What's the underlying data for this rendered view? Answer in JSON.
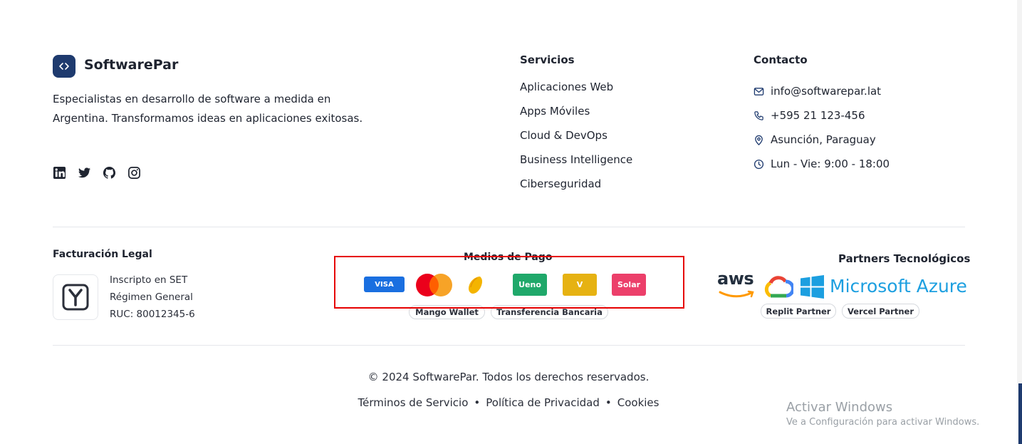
{
  "brand": {
    "name": "SoftwarePar",
    "description": "Especialistas en desarrollo de software a medida en Argentina. Transformamos ideas en aplicaciones exitosas.",
    "logo_color": "#1e3a6e",
    "social_icons": [
      "linkedin-icon",
      "twitter-icon",
      "github-icon",
      "instagram-icon"
    ]
  },
  "services": {
    "title": "Servicios",
    "items": [
      "Aplicaciones Web",
      "Apps Móviles",
      "Cloud & DevOps",
      "Business Intelligence",
      "Ciberseguridad"
    ]
  },
  "contact": {
    "title": "Contacto",
    "items": [
      {
        "icon": "mail-icon",
        "text": "info@softwarepar.lat"
      },
      {
        "icon": "phone-icon",
        "text": "+595 21 123-456"
      },
      {
        "icon": "map-pin-icon",
        "text": "Asunción, Paraguay"
      },
      {
        "icon": "clock-icon",
        "text": "Lun - Vie: 9:00 - 18:00"
      }
    ]
  },
  "billing": {
    "title": "Facturación Legal",
    "lines": [
      "Inscripto en SET",
      "Régimen General",
      "RUC: 80012345-6"
    ]
  },
  "payment": {
    "title": "Medios de Pago",
    "chips": [
      {
        "label": "VISA",
        "color": "#1a6fe0"
      },
      {
        "label": "",
        "icon": "mastercard-icon"
      },
      {
        "label": "",
        "icon": "mango-icon"
      },
      {
        "label": "Ueno",
        "color": "#1fa86a"
      },
      {
        "label": "V",
        "color": "#e6b212"
      },
      {
        "label": "Solar",
        "color": "#ec3f6a"
      }
    ],
    "pills": [
      "Mango Wallet",
      "Transferencia Bancaria"
    ]
  },
  "partners": {
    "title": "Partners Tecnológicos",
    "logos": [
      "aws",
      "Microsoft Azure"
    ],
    "pills": [
      "Replit Partner",
      "Vercel Partner"
    ]
  },
  "footer": {
    "copyright": "© 2024 SoftwarePar. Todos los derechos reservados.",
    "links": [
      "Términos de Servicio",
      "Política de Privacidad",
      "Cookies"
    ],
    "separator": "•"
  },
  "windows_watermark": {
    "line1": "Activar Windows",
    "line2": "Ve a Configuración para activar Windows."
  }
}
